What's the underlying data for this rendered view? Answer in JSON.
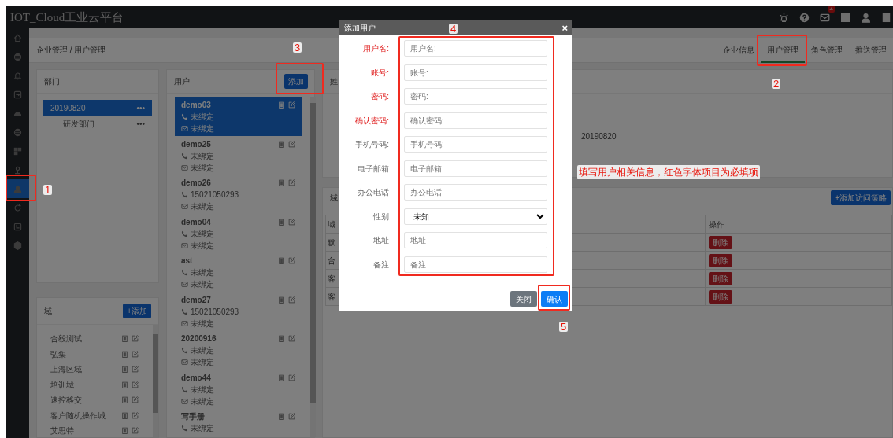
{
  "app": {
    "title": "IOT_Cloud工业云平台",
    "mail_badge": "4"
  },
  "sidebar": {
    "items": [
      {
        "selected": false
      },
      {
        "selected": false
      },
      {
        "selected": false
      },
      {
        "selected": false
      },
      {
        "selected": false
      },
      {
        "selected": false
      },
      {
        "selected": false
      },
      {
        "selected": false
      },
      {
        "selected": true
      },
      {
        "selected": false
      },
      {
        "selected": false
      },
      {
        "selected": false
      }
    ]
  },
  "breadcrumb": "企业管理 / 用户管理",
  "tabs": [
    {
      "label": "企业信息",
      "selected": false
    },
    {
      "label": "用户管理",
      "selected": true
    },
    {
      "label": "角色管理",
      "selected": false
    },
    {
      "label": "推送管理",
      "selected": false
    }
  ],
  "departments": {
    "title": "部门",
    "items": [
      {
        "label": "20190820",
        "menu": "•••",
        "selected": true,
        "children": [
          {
            "label": "研发部门",
            "menu": "•••",
            "selected": false
          }
        ]
      }
    ]
  },
  "domains": {
    "title": "域",
    "add_button": "+添加",
    "items": [
      "合毅测试",
      "弘集",
      "上海区域",
      "培训城",
      "速控移交",
      "客户随机操作城",
      "艾思特"
    ]
  },
  "users": {
    "title": "用户",
    "add_button": "添加",
    "items": [
      {
        "name": "demo03",
        "phone": "未绑定",
        "email": "未绑定",
        "selected": true
      },
      {
        "name": "demo25",
        "phone": "未绑定",
        "email": "未绑定",
        "selected": false
      },
      {
        "name": "demo26",
        "phone": "15021050293",
        "email": "未绑定",
        "selected": false
      },
      {
        "name": "demo04",
        "phone": "未绑定",
        "email": "未绑定",
        "selected": false
      },
      {
        "name": "ast",
        "phone": "未绑定",
        "email": "未绑定",
        "selected": false
      },
      {
        "name": "demo27",
        "phone": "15021050293",
        "email": "未绑定",
        "selected": false
      },
      {
        "name": "20200916",
        "phone": "未绑定",
        "email": "未绑定",
        "selected": false
      },
      {
        "name": "demo44",
        "phone": "未绑定",
        "email": "未绑定",
        "selected": false
      },
      {
        "name": "写手册",
        "phone": "未绑定",
        "selected": false
      }
    ]
  },
  "detail": {
    "header": "姓",
    "value": "20190820"
  },
  "policies": {
    "header": "域",
    "add_button": "+添加访问策略",
    "columns": [
      "域",
      "操作"
    ],
    "rows": [
      {
        "column_1": "默",
        "action": "删除"
      },
      {
        "column_1": "合",
        "action": "删除"
      },
      {
        "column_1": "客",
        "action": "删除"
      },
      {
        "column_1": "客",
        "action": "删除"
      }
    ]
  },
  "modal": {
    "title": "添加用户",
    "close": "×",
    "fields": [
      {
        "kind": "text",
        "label": "用户名:",
        "placeholder": "用户名:",
        "required": true
      },
      {
        "kind": "text",
        "label": "账号:",
        "placeholder": "账号:",
        "required": true
      },
      {
        "kind": "text",
        "label": "密码:",
        "placeholder": "密码:",
        "required": true
      },
      {
        "kind": "text",
        "label": "确认密码:",
        "placeholder": "确认密码:",
        "required": true
      },
      {
        "kind": "text",
        "label": "手机号码:",
        "placeholder": "手机号码:",
        "required": false
      },
      {
        "kind": "text",
        "label": "电子邮箱",
        "placeholder": "电子邮箱",
        "required": false
      },
      {
        "kind": "text",
        "label": "办公电话",
        "placeholder": "办公电话",
        "required": false
      },
      {
        "kind": "select",
        "label": "性别",
        "value": "未知",
        "required": false
      },
      {
        "kind": "text",
        "label": "地址",
        "placeholder": "地址",
        "required": false
      },
      {
        "kind": "text",
        "label": "备注",
        "placeholder": "备注",
        "required": false
      }
    ],
    "buttons": [
      {
        "label": "关闭",
        "kind": "secondary"
      },
      {
        "label": "确认",
        "kind": "primary"
      }
    ]
  },
  "annotations": {
    "note": "填写用户相关信息，红色字体项目为必填项",
    "markers": [
      "1",
      "2",
      "3",
      "4",
      "5"
    ]
  }
}
